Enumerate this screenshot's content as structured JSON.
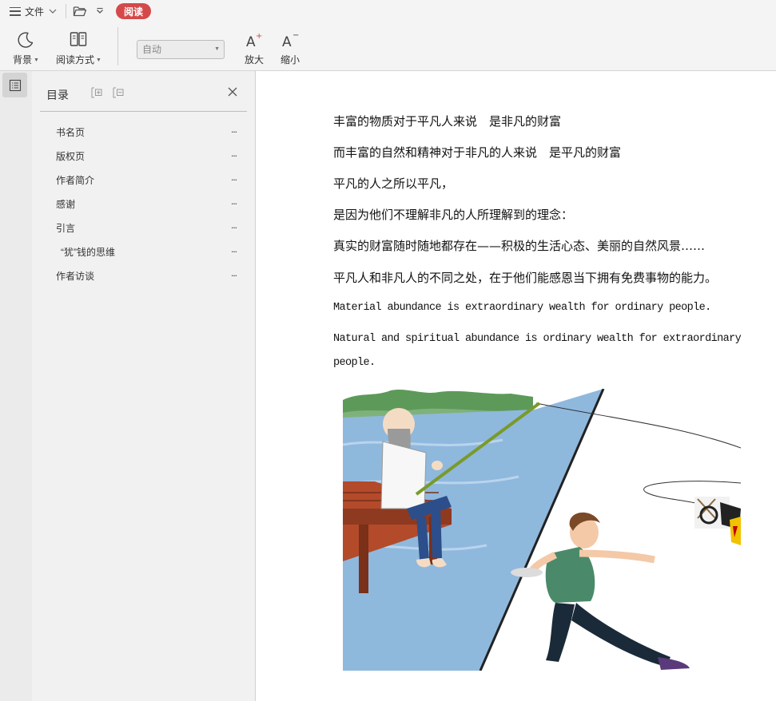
{
  "topbar": {
    "file_menu_label": "文件",
    "read_badge_label": "阅读"
  },
  "toolbar": {
    "background_label": "背景",
    "read_mode_label": "阅读方式",
    "zoom_select_value": "自动",
    "zoom_in_label": "放大",
    "zoom_out_label": "缩小"
  },
  "toc": {
    "title": "目录",
    "items": [
      {
        "label": "书名页",
        "more": "..."
      },
      {
        "label": "版权页",
        "more": "..."
      },
      {
        "label": "作者简介",
        "more": "..."
      },
      {
        "label": "感谢",
        "more": "..."
      },
      {
        "label": "引言",
        "more": "..."
      },
      {
        "label": "“犹”钱的思维",
        "more": "..."
      },
      {
        "label": "作者访谈",
        "more": "..."
      }
    ]
  },
  "content": {
    "lines": [
      "丰富的物质对于平凡人来说　是非凡的财富",
      "而丰富的自然和精神对于非凡的人来说　是平凡的财富",
      "平凡的人之所以平凡，",
      "是因为他们不理解非凡的人所理解到的理念：",
      "真实的财富随时随地都存在——积极的生活心态、美丽的自然风景……",
      "平凡人和非凡人的不同之处，在于他们能感恩当下拥有免费事物的能力。"
    ],
    "en_line1": "Material abundance is extraordinary wealth for ordinary people.",
    "en_line2a": "Natural and spiritual abundance is ordinary wealth for extraordinary",
    "en_line2b": "people."
  },
  "colors": {
    "read_badge": "#d44a4a",
    "toolbar_bg": "#f4f4f4",
    "toc_bg": "#f1f1f1",
    "rail_bg": "#ebebeb"
  }
}
